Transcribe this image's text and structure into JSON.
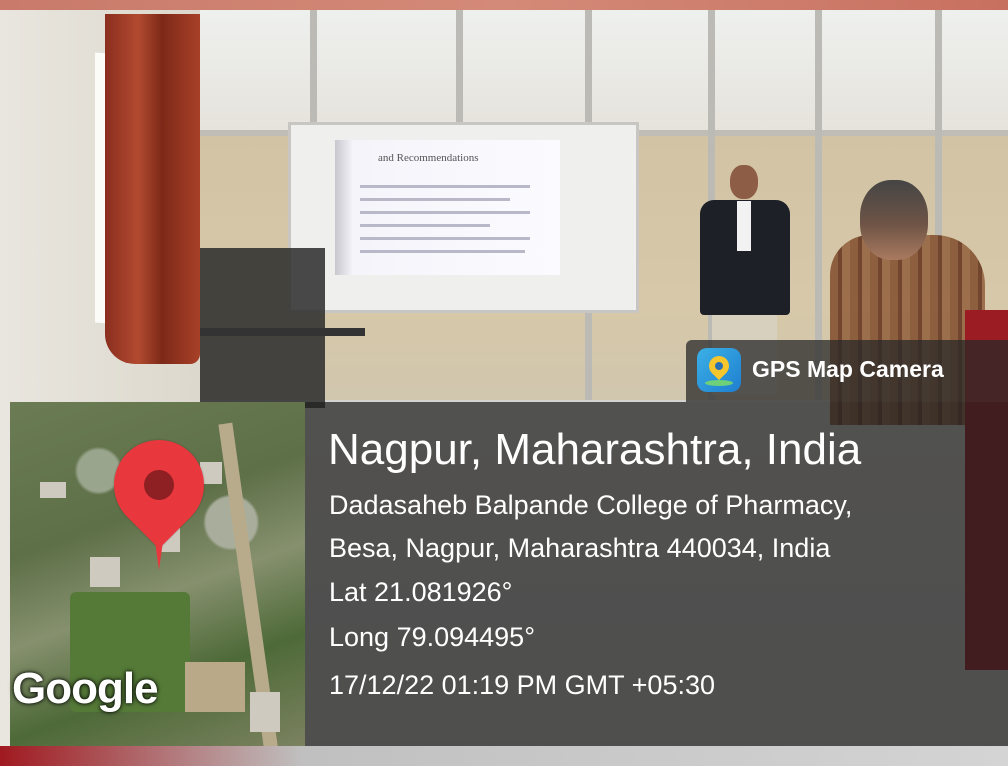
{
  "overlay": {
    "app_label": "GPS Map Camera",
    "app_icon": "gps-map-camera-icon",
    "location_title": "Nagpur, Maharashtra, India",
    "address_line1": "Dadasaheb Balpande College of Pharmacy,",
    "address_line2": "Besa, Nagpur, Maharashtra 440034, India",
    "latitude": "Lat 21.081926°",
    "longitude": "Long 79.094495°",
    "datetime": "17/12/22 01:19 PM GMT +05:30"
  },
  "map": {
    "logo": "Google",
    "marker_icon": "map-marker-icon",
    "marker_color": "#e8383d"
  },
  "slide": {
    "title": "and Recommendations"
  }
}
